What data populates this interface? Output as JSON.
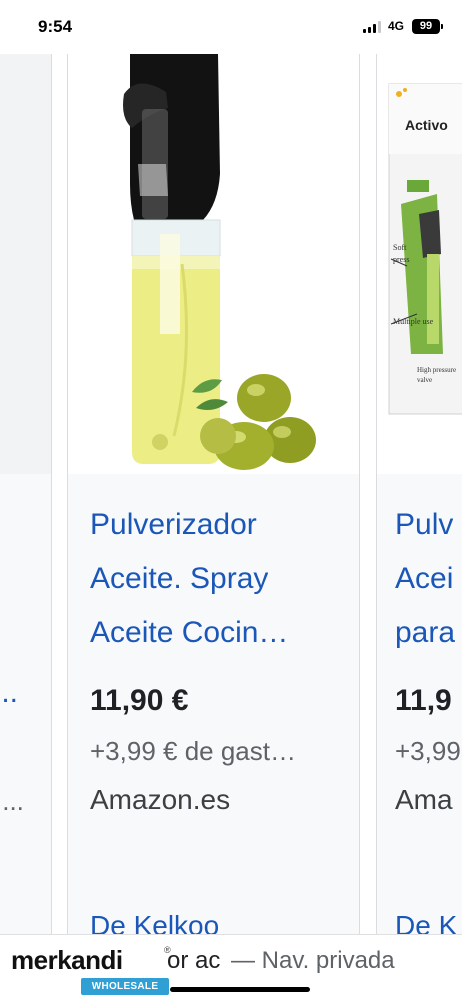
{
  "status_bar": {
    "time": "9:54",
    "network": "4G",
    "battery": "99"
  },
  "carousel": {
    "left_card": {
      "title_fragment": "...",
      "shipping_fragment": ":..."
    },
    "main_card": {
      "image": "olive-oil-spray-bottle-with-olives",
      "title_lines": [
        "Pulverizador",
        "Aceite. Spray",
        "Aceite Cocin…"
      ],
      "price": "11,90 €",
      "shipping": "+3,99 € de gast…",
      "store": "Amazon.es",
      "source": "De Kelkoo"
    },
    "right_card": {
      "image": "activo-oil-sprayer-box",
      "image_brand": "Activo",
      "title_lines": [
        "Pulv",
        "Acei",
        "para"
      ],
      "price": "11,9",
      "shipping": "+3,99",
      "store": "Ama",
      "source": "De K"
    }
  },
  "bottom_bar": {
    "logo_word": "merkandi",
    "logo_reg": "®",
    "logo_sub": "WHOLESALE",
    "url_fragment": "or ac",
    "private_label": "— Nav. privada"
  },
  "colors": {
    "link": "#1a57b8",
    "price": "#202124",
    "muted": "#5f6368",
    "logo_accent": "#2f9fd4"
  }
}
